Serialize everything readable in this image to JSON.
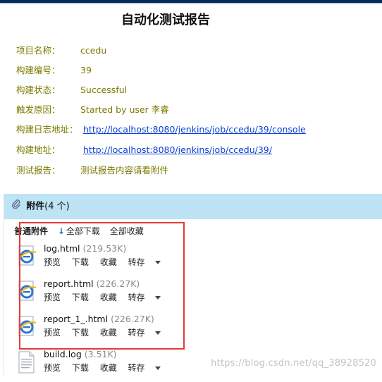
{
  "report": {
    "title": "自动化测试报告",
    "rows": [
      {
        "label": "项目名称：",
        "value": "ccedu"
      },
      {
        "label": "构建编号：",
        "value": "39"
      },
      {
        "label": "构建状态：",
        "value": "Successful"
      },
      {
        "label": "触发原因：",
        "value": "Started by user 李睿"
      },
      {
        "label": "构建日志地址：",
        "link": "http://localhost:8080/jenkins/job/ccedu/39/console"
      },
      {
        "label": "构建地址：",
        "link": "http://localhost:8080/jenkins/job/ccedu/39/"
      },
      {
        "label": "测试报告：",
        "value": "测试报告内容请看附件"
      }
    ]
  },
  "attachments": {
    "header_label": "附件",
    "header_count": "(4 个)",
    "toolbar": {
      "group": "普通附件",
      "download_all": "全部下载",
      "favorite_all": "全部收藏"
    },
    "files": [
      {
        "name": "log.html",
        "size": "(219.53K)",
        "type": "html"
      },
      {
        "name": "report.html",
        "size": "(226.27K)",
        "type": "html"
      },
      {
        "name": "report_1_.html",
        "size": "(226.27K)",
        "type": "html"
      },
      {
        "name": "build.log",
        "size": "(3.51K)",
        "type": "log"
      }
    ],
    "ops": {
      "preview": "预览",
      "download": "下载",
      "favorite": "收藏",
      "save_to": "转存"
    }
  },
  "watermark": "https://blog.csdn.net/qq_38928520",
  "colors": {
    "label": "#7a7a00",
    "link": "#0b3fd1",
    "header_bg": "#bde3f4",
    "highlight_box": "#e53b3b"
  }
}
